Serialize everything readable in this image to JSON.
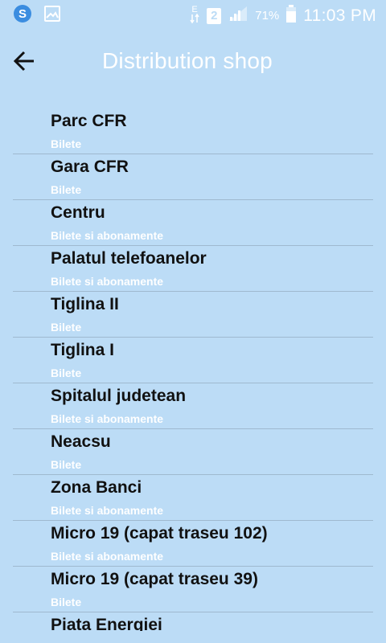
{
  "status_bar": {
    "icons_left": [
      "skype-icon",
      "gallery-icon"
    ],
    "network_label": "E",
    "sim_slot": "2",
    "battery_percent": "71%",
    "time": "11:03 PM"
  },
  "app_bar": {
    "back_icon": "arrow-back-icon",
    "title": "Distribution shop"
  },
  "colors": {
    "background": "#bcdcf6",
    "text_primary": "#111111",
    "text_secondary": "#ffffff",
    "divider": "#9fb9cf"
  },
  "list": {
    "items": [
      {
        "name": "Parc CFR",
        "type": "Bilete"
      },
      {
        "name": "Gara CFR",
        "type": "Bilete"
      },
      {
        "name": "Centru",
        "type": "Bilete si abonamente"
      },
      {
        "name": "Palatul telefoanelor",
        "type": "Bilete si abonamente"
      },
      {
        "name": "Tiglina II",
        "type": "Bilete"
      },
      {
        "name": "Tiglina I",
        "type": "Bilete"
      },
      {
        "name": "Spitalul judetean",
        "type": "Bilete si abonamente"
      },
      {
        "name": "Neacsu",
        "type": "Bilete"
      },
      {
        "name": "Zona Banci",
        "type": "Bilete si abonamente"
      },
      {
        "name": "Micro 19 (capat traseu 102)",
        "type": "Bilete si abonamente"
      },
      {
        "name": "Micro 19 (capat traseu 39)",
        "type": "Bilete"
      },
      {
        "name": "Piata Energiei",
        "type": ""
      }
    ]
  }
}
